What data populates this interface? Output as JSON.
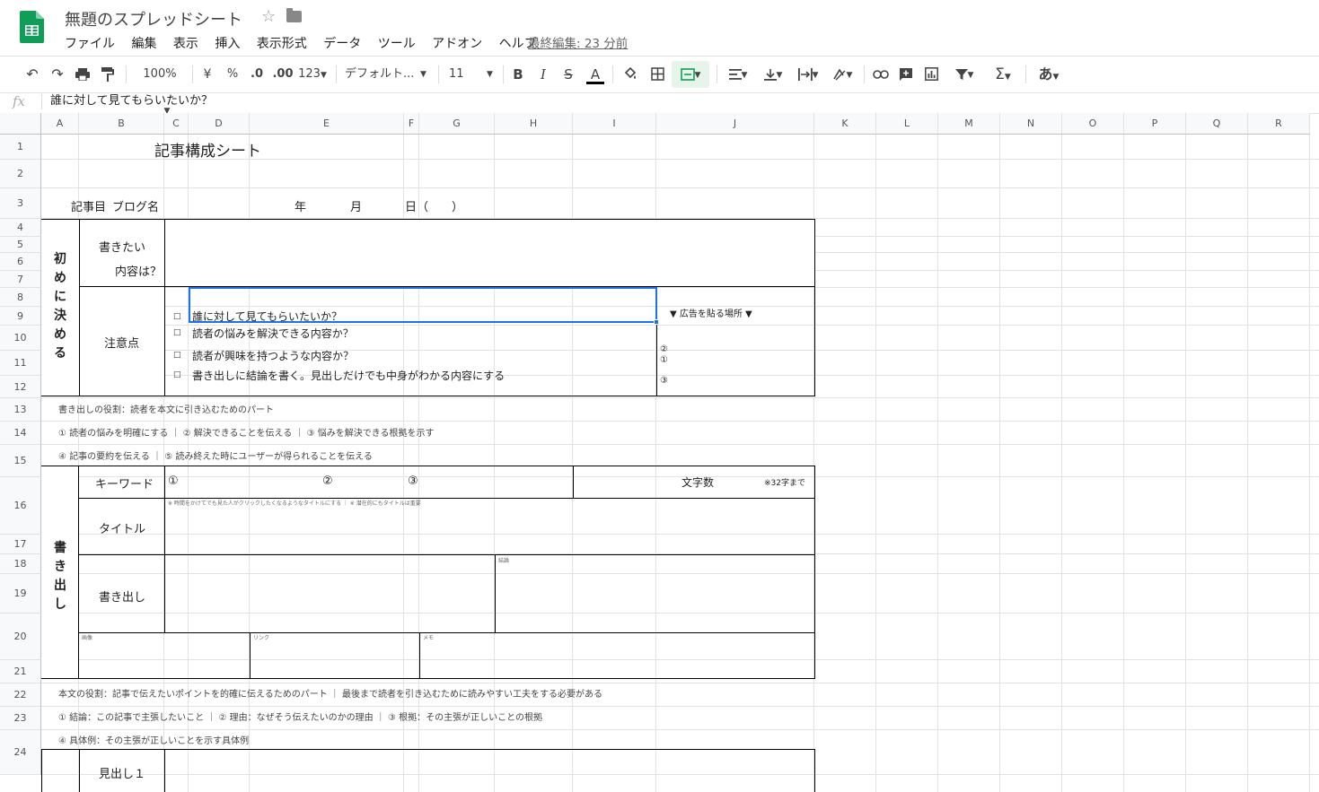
{
  "app": {
    "doc_title": "無題のスプレッドシート",
    "last_edit": "最終編集: 23 分前",
    "menus": [
      "ファイル",
      "編集",
      "表示",
      "挿入",
      "表示形式",
      "データ",
      "ツール",
      "アドオン",
      "ヘルプ"
    ]
  },
  "toolbar": {
    "zoom": "100%",
    "currency": "¥",
    "percent": "%",
    "dec_less": ".0",
    "dec_more": ".00",
    "more_formats": "123",
    "font": "デフォルト...",
    "font_size": "11",
    "bold": "B",
    "italic": "I",
    "strike": "S",
    "text_color": "A",
    "input_tool": "あ"
  },
  "formula_bar": {
    "fx": "fx",
    "value": "誰に対して見てもらいたいか？"
  },
  "columns": [
    "A",
    "B",
    "C",
    "D",
    "E",
    "F",
    "G",
    "H",
    "I",
    "J",
    "K",
    "L",
    "M",
    "N",
    "O",
    "P",
    "Q",
    "R"
  ],
  "rows": [
    "1",
    "2",
    "3",
    "4",
    "5",
    "6",
    "7",
    "8",
    "9",
    "10",
    "11",
    "12",
    "13",
    "14",
    "15",
    "16",
    "17",
    "18",
    "19",
    "20",
    "21",
    "22",
    "23",
    "24"
  ],
  "sheet": {
    "title": "記事構成シート",
    "r3_article_no": "記事目",
    "r3_blog_name": "ブログ名",
    "r3_year": "年",
    "r3_month": "月",
    "r3_day": "日（　　）",
    "sec1_vertical": [
      "初",
      "め",
      "に",
      "決",
      "め",
      "る"
    ],
    "want_l1": "書きたい",
    "want_l2": "内容は？",
    "caution_label": "注意点",
    "check_mark": "□",
    "check1": "誰に対して見てもらいたいか？",
    "check2": "読者の悩みを解決できる内容か？",
    "check3": "読者が興味を持つような内容か？",
    "check4": "書き出しに結論を書く。見出しだけでも中身がわかる内容にする",
    "ad_label": "▼ 広告を貼る場所 ▼",
    "ad_2": "②",
    "ad_1": "①",
    "ad_3": "③",
    "note12": "書き出しの役割：読者を本文に引き込むためのパート",
    "note13": "① 読者の悩みを明確にする ｜ ② 解決できることを伝える ｜ ③ 悩みを解決できる根拠を示す",
    "note14": "④ 記事の要約を伝える ｜ ⑤ 読み終えた時にユーザーが得られることを伝える",
    "sec2_vertical": [
      "書",
      "き",
      "出",
      "し"
    ],
    "keyword_label": "キーワード",
    "kw1": "①",
    "kw2": "②",
    "kw3": "③",
    "charcount_label": "文字数",
    "charcount_note": "※32字まで",
    "title_note": "※ 時間をかけてでも見た人がクリックしたくなるようなタイトルにする ｜ ※ 潜在的にもタイトルは重要",
    "title_label": "タイトル",
    "conclusion_note": "結論",
    "intro_label": "書き出し",
    "r20_a": "画像",
    "r20_b": "リンク",
    "r20_c": "メモ",
    "note21": "本文の役割：記事で伝えたいポイントを的確に伝えるためのパート ｜ 最後まで読者を引き込むために読みやすい工夫をする必要がある",
    "note22": "① 結論：この記事で主張したいこと ｜ ② 理由：なぜそう伝えたいのかの理由 ｜ ③ 根拠：その主張が正しいことの根拠",
    "note23": "④ 具体例：その主張が正しいことを示す具体例",
    "heading1": "見出し１"
  },
  "colors": {
    "sheets_green": "#0f9d58",
    "selection_blue": "#1a73e8",
    "toolbar_active": "#e6f4ea"
  }
}
